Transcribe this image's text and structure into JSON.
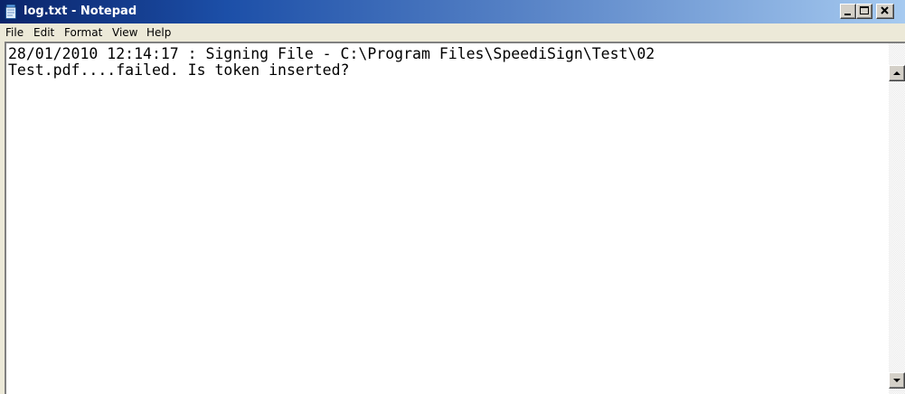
{
  "window": {
    "title": "log.txt - Notepad"
  },
  "menu": {
    "items": [
      {
        "label": "File"
      },
      {
        "label": "Edit"
      },
      {
        "label": "Format"
      },
      {
        "label": "View"
      },
      {
        "label": "Help"
      }
    ]
  },
  "editor": {
    "lines": [
      "28/01/2010 12:14:17 : Signing File - C:\\Program Files\\SpeediSign\\Test\\02",
      "Test.pdf....failed. Is token inserted?"
    ]
  },
  "icons": {
    "app": "notepad-icon",
    "minimize": "minimize-icon",
    "maximize": "maximize-icon",
    "close": "close-icon",
    "scroll_up": "arrow-up-icon",
    "scroll_down": "arrow-down-icon"
  },
  "colors": {
    "titlebar_start": "#0a246a",
    "titlebar_end": "#a6caf0",
    "chrome": "#ece9d8",
    "text": "#000000",
    "editor_bg": "#ffffff"
  }
}
